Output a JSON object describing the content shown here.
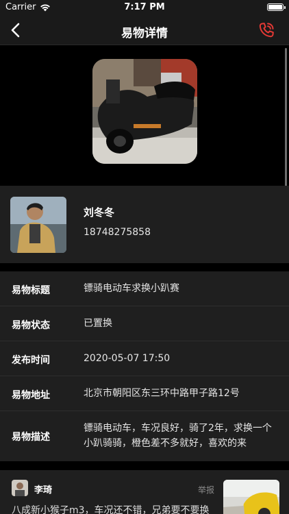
{
  "status_bar": {
    "carrier": "Carrier",
    "time": "7:17 PM"
  },
  "nav": {
    "title": "易物详情",
    "back_icon": "chevron-left-icon",
    "call_icon": "phone-icon",
    "accent_color": "#e53935"
  },
  "owner": {
    "name": "刘冬冬",
    "phone": "18748275858"
  },
  "details": [
    {
      "label": "易物标题",
      "value": "镖骑电动车求换小趴赛"
    },
    {
      "label": "易物状态",
      "value": "已置换"
    },
    {
      "label": "发布时间",
      "value": "2020-05-07 17:50"
    },
    {
      "label": "易物地址",
      "value": "北京市朝阳区东三环中路甲子路12号"
    },
    {
      "label": "易物描述",
      "value": "镖骑电动车，车况良好，骑了2年，求换一个小趴骑骑，橙色差不多就好，喜欢的来"
    }
  ],
  "post": {
    "name": "李琦",
    "report_label": "举报",
    "text": "八成新小猴子m3，车况还不错，兄弟要不要换"
  }
}
